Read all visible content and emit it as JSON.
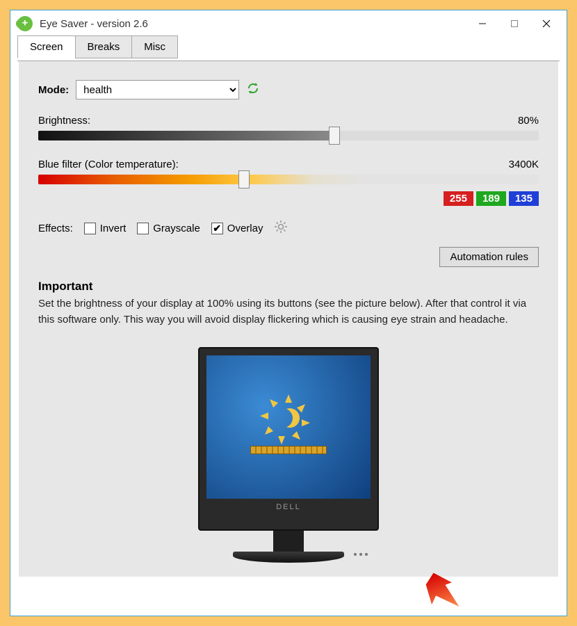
{
  "window": {
    "title": "Eye Saver - version 2.6"
  },
  "tabs": [
    "Screen",
    "Breaks",
    "Misc"
  ],
  "mode": {
    "label": "Mode:",
    "value": "health"
  },
  "brightness": {
    "label": "Brightness:",
    "value_text": "80%",
    "percent": 58
  },
  "colortemp": {
    "label": "Blue filter (Color temperature):",
    "value_text": "3400K",
    "percent": 40
  },
  "rgb": {
    "r": "255",
    "g": "189",
    "b": "135"
  },
  "effects": {
    "label": "Effects:",
    "invert": {
      "label": "Invert",
      "checked": false
    },
    "grayscale": {
      "label": "Grayscale",
      "checked": false
    },
    "overlay": {
      "label": "Overlay",
      "checked": true
    }
  },
  "automation_btn": "Automation rules",
  "important": {
    "heading": "Important",
    "body": "Set the brightness of your display at 100% using its buttons (see the picture below). After that control it via this software only. This way you will avoid display flickering which is causing eye strain and headache."
  },
  "monitor_brand": "DELL"
}
